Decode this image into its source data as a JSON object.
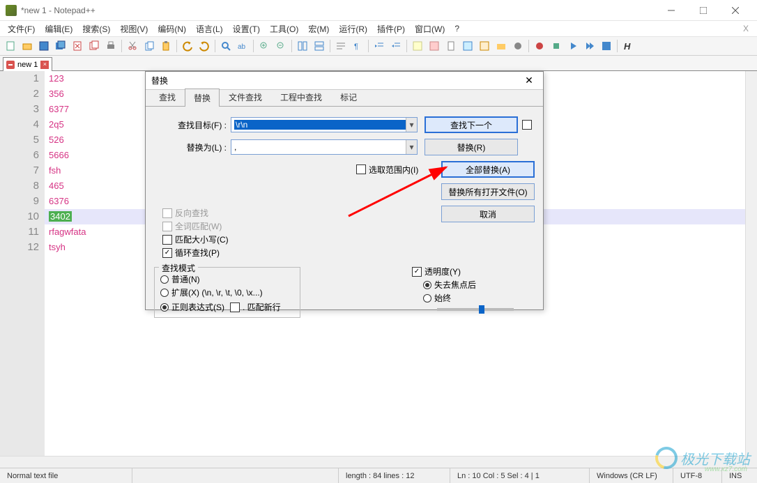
{
  "window": {
    "title": "*new 1 - Notepad++"
  },
  "menu": [
    "文件(F)",
    "编辑(E)",
    "搜索(S)",
    "视图(V)",
    "编码(N)",
    "语言(L)",
    "设置(T)",
    "工具(O)",
    "宏(M)",
    "运行(R)",
    "插件(P)",
    "窗口(W)",
    "?"
  ],
  "tab": {
    "name": "new 1"
  },
  "lines": [
    "123",
    "356",
    "6377",
    "2q5",
    "526",
    "5666",
    "fsh",
    "465",
    "6376",
    "3402",
    "rfagwfata",
    "tsyh"
  ],
  "highlight_line": 10,
  "dialog": {
    "title": "替换",
    "tabs": [
      "查找",
      "替换",
      "文件查找",
      "工程中查找",
      "标记"
    ],
    "active_tab": 1,
    "find_label": "查找目标(F) :",
    "find_value": "\\r\\n",
    "replace_label": "替换为(L) :",
    "replace_value": ",",
    "in_selection": "选取范围内(I)",
    "btn_find_next": "查找下一个",
    "btn_replace": "替换(R)",
    "btn_replace_all": "全部替换(A)",
    "btn_replace_open": "替换所有打开文件(O)",
    "btn_cancel": "取消",
    "opt_backward": "反向查找",
    "opt_whole": "全词匹配(W)",
    "opt_case": "匹配大小写(C)",
    "opt_wrap": "循环查找(P)",
    "grp_mode": "查找模式",
    "mode_normal": "普通(N)",
    "mode_ext": "扩展(X) (\\n, \\r, \\t, \\0, \\x...)",
    "mode_regex": "正则表达式(S)",
    "mode_nl": ". 匹配新行",
    "grp_trans": "透明度(Y)",
    "trans_lose": "失去焦点后",
    "trans_always": "始终"
  },
  "status": {
    "type": "Normal text file",
    "length": "length : 84     lines : 12",
    "pos": "Ln : 10    Col : 5    Sel : 4 | 1",
    "eol": "Windows (CR LF)",
    "enc": "UTF-8",
    "ins": "INS"
  },
  "watermark": {
    "t1": "极光下载站",
    "t2": "www.xz7.com"
  }
}
